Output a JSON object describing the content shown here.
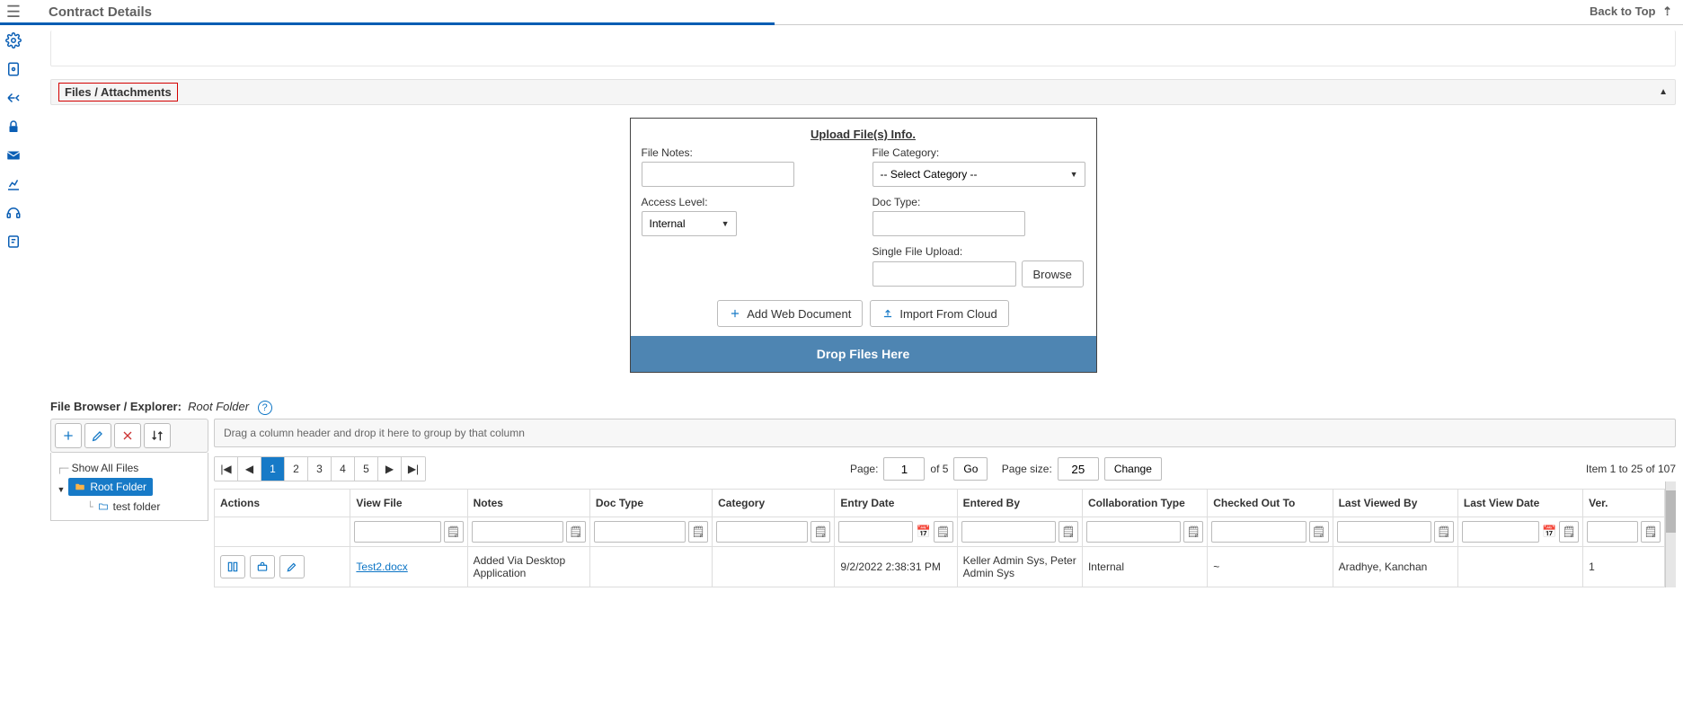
{
  "header": {
    "title": "Contract Details",
    "back_to_top": "Back to Top"
  },
  "section": {
    "title": "Files / Attachments"
  },
  "upload": {
    "heading": "Upload File(s) Info.",
    "file_notes_label": "File Notes:",
    "access_level_label": "Access Level:",
    "access_level_value": "Internal",
    "file_category_label": "File Category:",
    "file_category_value": "-- Select Category --",
    "doc_type_label": "Doc Type:",
    "single_file_label": "Single File Upload:",
    "browse_label": "Browse",
    "add_web_doc_label": "Add Web Document",
    "import_cloud_label": "Import From Cloud",
    "drop_label": "Drop Files Here"
  },
  "browser": {
    "label_prefix": "File Browser / Explorer:",
    "current": "Root Folder",
    "show_all": "Show All Files",
    "root": "Root Folder",
    "sub1": "test folder"
  },
  "grid": {
    "group_hint": "Drag a column header and drop it here to group by that column",
    "pages": [
      "1",
      "2",
      "3",
      "4",
      "5"
    ],
    "active_page": "1",
    "page_label": "Page:",
    "page_input": "1",
    "of_label": "of 5",
    "go_label": "Go",
    "page_size_label": "Page size:",
    "page_size_value": "25",
    "change_label": "Change",
    "item_range": "Item 1 to 25 of 107",
    "columns": {
      "actions": "Actions",
      "view_file": "View File",
      "notes": "Notes",
      "doc_type": "Doc Type",
      "category": "Category",
      "entry_date": "Entry Date",
      "entered_by": "Entered By",
      "collab_type": "Collaboration Type",
      "checked_out": "Checked Out To",
      "last_viewed_by": "Last Viewed By",
      "last_view_date": "Last View Date",
      "ver": "Ver."
    },
    "row1": {
      "view_file": "Test2.docx",
      "notes": "Added Via Desktop Application",
      "doc_type": "",
      "category": "",
      "entry_date": "9/2/2022 2:38:31 PM",
      "entered_by": "Keller Admin Sys, Peter Admin Sys",
      "collab_type": "Internal",
      "checked_out": "~",
      "last_viewed_by": "Aradhye, Kanchan",
      "last_view_date": "",
      "ver": "1"
    }
  }
}
